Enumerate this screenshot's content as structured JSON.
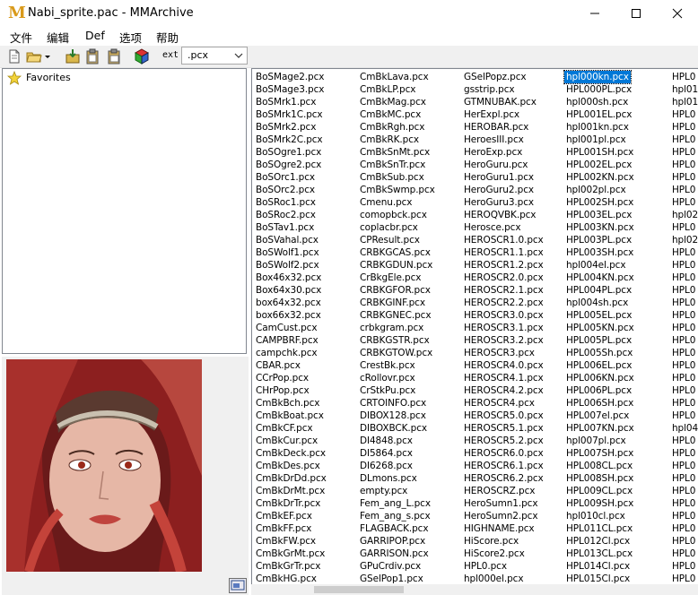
{
  "window": {
    "title": "Nabi_sprite.pac - MMArchive",
    "logo_letter": "M"
  },
  "menu": [
    "文件",
    "编辑",
    "Def",
    "选项",
    "帮助"
  ],
  "toolbar": {
    "ext_label": "ext",
    "ext_value": ".pcx"
  },
  "tree": {
    "favorites_label": "Favorites"
  },
  "colors": {
    "selection": "#0078d7",
    "logo": "#d99a1b"
  },
  "file_columns": [
    [
      "BoSMage2.pcx",
      "BoSMage3.pcx",
      "BoSMrk1.pcx",
      "BoSMrk1C.pcx",
      "BoSMrk2.pcx",
      "BoSMrk2C.pcx",
      "BoSOgre1.pcx",
      "BoSOgre2.pcx",
      "BoSOrc1.pcx",
      "BoSOrc2.pcx",
      "BoSRoc1.pcx",
      "BoSRoc2.pcx",
      "BoSTav1.pcx",
      "BoSVahal.pcx",
      "BoSWolf1.pcx",
      "BoSWolf2.pcx",
      "Box46x32.pcx",
      "Box64x30.pcx",
      "box64x32.pcx",
      "box66x32.pcx",
      "CamCust.pcx",
      "CAMPBRF.pcx",
      "campchk.pcx",
      "CBAR.pcx",
      "CCrPop.pcx",
      "CHrPop.pcx",
      "CmBkBch.pcx",
      "CmBkBoat.pcx",
      "CmBkCF.pcx",
      "CmBkCur.pcx",
      "CmBkDeck.pcx",
      "CmBkDes.pcx",
      "CmBkDrDd.pcx",
      "CmBkDrMt.pcx",
      "CmBkDrTr.pcx",
      "CmBkEF.pcx",
      "CmBkFF.pcx",
      "CmBkFW.pcx",
      "CmBkGrMt.pcx",
      "CmBkGrTr.pcx",
      "CmBkHG.pcx"
    ],
    [
      "CmBkLava.pcx",
      "CmBkLP.pcx",
      "CmBkMag.pcx",
      "CmBkMC.pcx",
      "CmBkRgh.pcx",
      "CmBkRK.pcx",
      "CmBkSnMt.pcx",
      "CmBkSnTr.pcx",
      "CmBkSub.pcx",
      "CmBkSwmp.pcx",
      "Cmenu.pcx",
      "comopbck.pcx",
      "coplacbr.pcx",
      "CPResult.pcx",
      "CRBKGCAS.pcx",
      "CRBKGDUN.pcx",
      "CrBkgEle.pcx",
      "CRBKGFOR.pcx",
      "CRBKGINF.pcx",
      "CRBKGNEC.pcx",
      "crbkgram.pcx",
      "CRBKGSTR.pcx",
      "CRBKGTOW.pcx",
      "CrestBk.pcx",
      "cRollovr.pcx",
      "CrStkPu.pcx",
      "CRTOINFO.pcx",
      "DIBOX128.pcx",
      "DIBOXBCK.pcx",
      "DI4848.pcx",
      "DI5864.pcx",
      "DI6268.pcx",
      "DLmons.pcx",
      "empty.pcx",
      "Fem_ang_L.pcx",
      "Fem_ang_s.pcx",
      "FLAGBACK.pcx",
      "GARRIPOP.pcx",
      "GARRISON.pcx",
      "GPuCrdiv.pcx",
      "GSelPop1.pcx"
    ],
    [
      "GSelPopz.pcx",
      "gsstrip.pcx",
      "GTMNUBAK.pcx",
      "HerExpl.pcx",
      "HEROBAR.pcx",
      "HeroesIII.pcx",
      "HeroExp.pcx",
      "HeroGuru.pcx",
      "HeroGuru1.pcx",
      "HeroGuru2.pcx",
      "HeroGuru3.pcx",
      "HEROQVBK.pcx",
      "Herosce.pcx",
      "HEROSCR1.0.pcx",
      "HEROSCR1.1.pcx",
      "HEROSCR1.2.pcx",
      "HEROSCR2.0.pcx",
      "HEROSCR2.1.pcx",
      "HEROSCR2.2.pcx",
      "HEROSCR3.0.pcx",
      "HEROSCR3.1.pcx",
      "HEROSCR3.2.pcx",
      "HEROSCR3.pcx",
      "HEROSCR4.0.pcx",
      "HEROSCR4.1.pcx",
      "HEROSCR4.2.pcx",
      "HEROSCR4.pcx",
      "HEROSCR5.0.pcx",
      "HEROSCR5.1.pcx",
      "HEROSCR5.2.pcx",
      "HEROSCR6.0.pcx",
      "HEROSCR6.1.pcx",
      "HEROSCR6.2.pcx",
      "HEROSCRZ.pcx",
      "HeroSumn1.pcx",
      "HeroSumn2.pcx",
      "HIGHNAME.pcx",
      "HiScore.pcx",
      "HiScore2.pcx",
      "HPL0.pcx",
      "hpl000el.pcx"
    ],
    [
      "hpl000kn.pcx",
      "HPL000PL.pcx",
      "hpl000sh.pcx",
      "HPL001EL.pcx",
      "hpl001kn.pcx",
      "hpl001pl.pcx",
      "HPL001SH.pcx",
      "HPL002EL.pcx",
      "HPL002KN.pcx",
      "hpl002pl.pcx",
      "HPL002SH.pcx",
      "HPL003EL.pcx",
      "HPL003KN.pcx",
      "HPL003PL.pcx",
      "HPL003SH.pcx",
      "hpl004el.pcx",
      "HPL004KN.pcx",
      "HPL004PL.pcx",
      "hpl004sh.pcx",
      "HPL005EL.pcx",
      "HPL005KN.pcx",
      "HPL005PL.pcx",
      "HPL005Sh.pcx",
      "HPL006EL.pcx",
      "HPL006KN.pcx",
      "HPL006PL.pcx",
      "HPL006SH.pcx",
      "HPL007el.pcx",
      "HPL007KN.pcx",
      "hpl007pl.pcx",
      "HPL007SH.pcx",
      "HPL008CL.pcx",
      "HPL008SH.pcx",
      "HPL009CL.pcx",
      "HPL009SH.pcx",
      "hpl010cl.pcx",
      "HPL011CL.pcx",
      "HPL012Cl.pcx",
      "HPL013CL.pcx",
      "HPL014Cl.pcx",
      "HPL015Cl.pcx"
    ],
    [
      "HPL0",
      "hpl01",
      "hpl01",
      "HPL0",
      "HPL0",
      "HPL0",
      "HPL0",
      "HPL0",
      "HPL0",
      "HPL0",
      "HPL0",
      "hpl02",
      "HPL0",
      "hpl02",
      "HPL0",
      "HPL0",
      "HPL0",
      "HPL0",
      "HPL0",
      "HPL0",
      "HPL0",
      "HPL0",
      "HPL0",
      "HPL0",
      "HPL0",
      "HPL0",
      "HPL0",
      "HPL0",
      "hpl04",
      "HPL0",
      "HPL0",
      "HPL0",
      "HPL0",
      "HPL0",
      "HPL0",
      "HPL0",
      "HPL0",
      "HPL0",
      "HPL0",
      "HPL0",
      "HPL0"
    ]
  ],
  "selected": {
    "column": 3,
    "row": 0
  }
}
